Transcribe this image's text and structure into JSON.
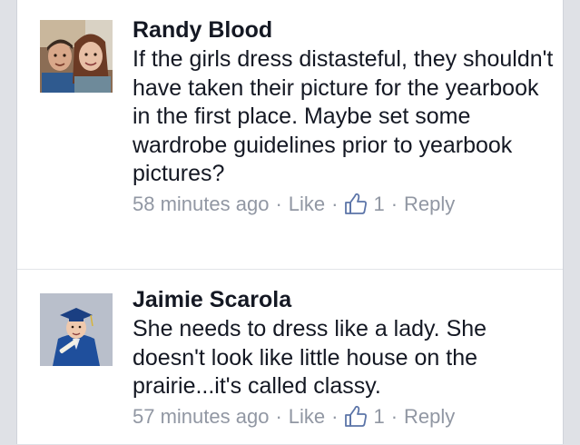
{
  "comments": [
    {
      "author": "Randy Blood",
      "text": "If the girls dress distasteful, they shouldn't have taken their picture for the yearbook in the first place. Maybe set some wardrobe guidelines prior to yearbook pictures?",
      "time": "58 minutes ago",
      "like_label": "Like",
      "like_count": "1",
      "reply_label": "Reply",
      "avatar_icon": "couple-photo-avatar"
    },
    {
      "author": "Jaimie Scarola",
      "text": "She needs to dress like a lady.  She doesn't look like little house on the prairie...it's called classy.",
      "time": "57 minutes ago",
      "like_label": "Like",
      "like_count": "1",
      "reply_label": "Reply",
      "avatar_icon": "graduate-photo-avatar"
    }
  ],
  "separator": "·",
  "colors": {
    "text": "#141823",
    "meta": "#9197a3",
    "thumb_stroke": "#5b74a8",
    "background": "#dfe1e6",
    "card": "#ffffff"
  }
}
